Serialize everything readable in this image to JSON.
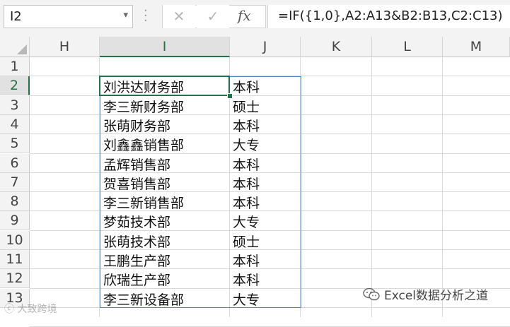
{
  "name_box": {
    "value": "I2"
  },
  "formula_bar": {
    "cancel_icon": "close-icon",
    "enter_icon": "check-icon",
    "fx_label": "fx",
    "formula": "=IF({1,0},A2:A13&B2:B13,C2:C13)"
  },
  "columns": [
    {
      "label": "H",
      "selected": false
    },
    {
      "label": "I",
      "selected": true
    },
    {
      "label": "J",
      "selected": false
    },
    {
      "label": "K",
      "selected": false
    },
    {
      "label": "L",
      "selected": false
    },
    {
      "label": "M",
      "selected": false
    }
  ],
  "rows": [
    {
      "label": "1",
      "selected": false,
      "i": "",
      "j": ""
    },
    {
      "label": "2",
      "selected": true,
      "i": "刘洪达财务部",
      "j": "本科"
    },
    {
      "label": "3",
      "selected": false,
      "i": "李三新财务部",
      "j": "硕士"
    },
    {
      "label": "4",
      "selected": false,
      "i": "张萌财务部",
      "j": "本科"
    },
    {
      "label": "5",
      "selected": false,
      "i": "刘鑫鑫销售部",
      "j": "大专"
    },
    {
      "label": "6",
      "selected": false,
      "i": "孟辉销售部",
      "j": "本科"
    },
    {
      "label": "7",
      "selected": false,
      "i": "贺喜销售部",
      "j": "本科"
    },
    {
      "label": "8",
      "selected": false,
      "i": "李三新销售部",
      "j": "本科"
    },
    {
      "label": "9",
      "selected": false,
      "i": "梦茹技术部",
      "j": "大专"
    },
    {
      "label": "10",
      "selected": false,
      "i": "张萌技术部",
      "j": "硕士"
    },
    {
      "label": "11",
      "selected": false,
      "i": "王鹏生产部",
      "j": "本科"
    },
    {
      "label": "12",
      "selected": false,
      "i": "欣瑞生产部",
      "j": "本科"
    },
    {
      "label": "13",
      "selected": false,
      "i": "李三新设备部",
      "j": "大专"
    }
  ],
  "watermark": {
    "right_text": "Excel数据分析之道",
    "left_text": "ⓒ 大致跨境"
  },
  "colors": {
    "accent": "#217346",
    "range": "#4a86c8"
  }
}
